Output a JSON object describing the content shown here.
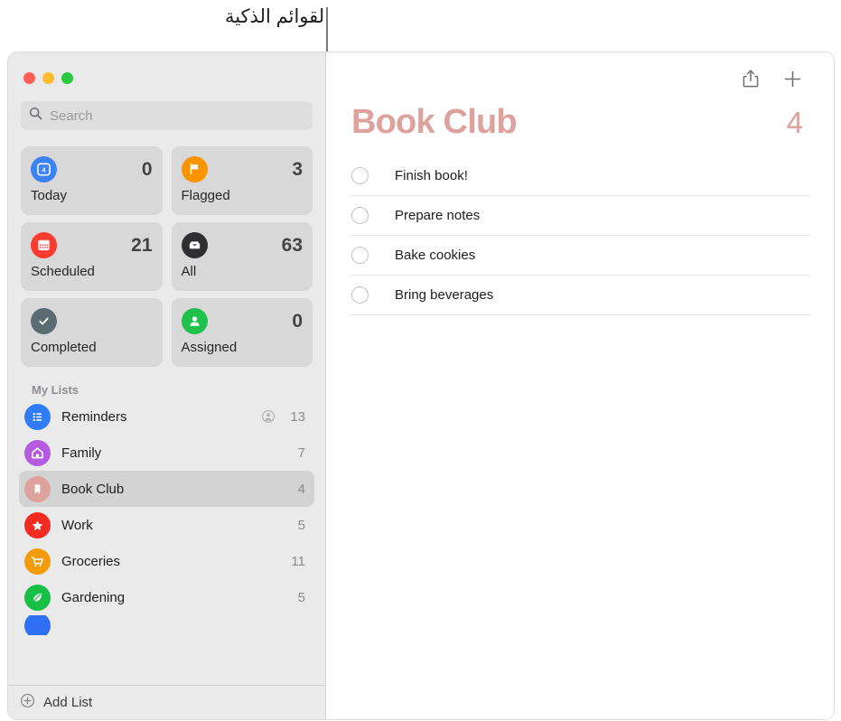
{
  "annotation": {
    "label": "القوائم الذكية",
    "icon": "callout-leader-line"
  },
  "window": {
    "traffic_lights": {
      "close": "close-window-button",
      "minimize": "minimize-window-button",
      "zoom": "zoom-window-button"
    }
  },
  "sidebar": {
    "search": {
      "placeholder": "Search",
      "value": "",
      "icon": "search-icon"
    },
    "smart_lists": [
      {
        "label": "Today",
        "count": "0",
        "icon": "calendar-today-icon",
        "icon_color": "#3b82f7",
        "glyph": "4"
      },
      {
        "label": "Flagged",
        "count": "3",
        "icon": "flag-icon",
        "icon_color": "#fa9500"
      },
      {
        "label": "Scheduled",
        "count": "21",
        "icon": "calendar-icon",
        "icon_color": "#ff3b30"
      },
      {
        "label": "All",
        "count": "63",
        "icon": "inbox-tray-icon",
        "icon_color": "#2f2f32"
      },
      {
        "label": "Completed",
        "count": "",
        "icon": "checkmark-icon",
        "icon_color": "#5a6b72"
      },
      {
        "label": "Assigned",
        "count": "0",
        "icon": "person-icon",
        "icon_color": "#1fc14b"
      }
    ],
    "my_lists_header": "My Lists",
    "lists": [
      {
        "name": "Reminders",
        "count": "13",
        "icon": "bulleted-list-icon",
        "icon_color": "#2f7cf6",
        "shared": true
      },
      {
        "name": "Family",
        "count": "7",
        "icon": "house-icon",
        "icon_color": "#b45be0",
        "shared": false
      },
      {
        "name": "Book Club",
        "count": "4",
        "icon": "bookmark-icon",
        "icon_color": "#dda29d",
        "shared": false,
        "selected": true
      },
      {
        "name": "Work",
        "count": "5",
        "icon": "star-icon",
        "icon_color": "#f42b21",
        "shared": false
      },
      {
        "name": "Groceries",
        "count": "11",
        "icon": "shopping-cart-icon",
        "icon_color": "#f49b0b",
        "shared": false
      },
      {
        "name": "Gardening",
        "count": "5",
        "icon": "leaf-icon",
        "icon_color": "#17c045",
        "shared": false
      }
    ],
    "partial_list": {
      "icon_color": "#2f6ff6"
    },
    "add_list": {
      "label": "Add List",
      "icon": "plus-circle-icon"
    }
  },
  "content": {
    "toolbar": {
      "share": "share-icon",
      "add": "plus-icon"
    },
    "title": "Book Club",
    "total": "4",
    "accent_color": "#dda29d",
    "tasks": [
      {
        "text": "Finish book!",
        "done": false
      },
      {
        "text": "Prepare notes",
        "done": false
      },
      {
        "text": "Bake cookies",
        "done": false
      },
      {
        "text": "Bring beverages",
        "done": false
      }
    ]
  }
}
